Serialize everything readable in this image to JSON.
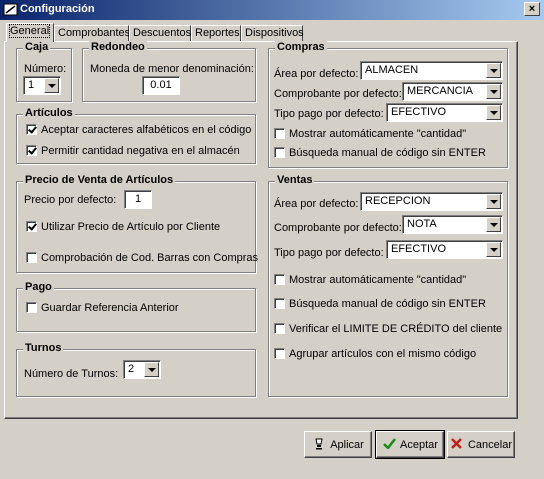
{
  "window": {
    "title": "Configuración",
    "close_glyph": "×",
    "icon": "config-icon"
  },
  "tabs": [
    {
      "label": "General",
      "active": true
    },
    {
      "label": "Comprobantes",
      "active": false
    },
    {
      "label": "Descuentos",
      "active": false
    },
    {
      "label": "Reportes",
      "active": false
    },
    {
      "label": "Dispositivos",
      "active": false
    }
  ],
  "caja": {
    "legend": "Caja",
    "numero_label": "Número:",
    "numero_value": "1"
  },
  "redondeo": {
    "legend": "Redondeo",
    "label": "Moneda de menor denominación:",
    "value": "0.01"
  },
  "articulos": {
    "legend": "Artículos",
    "opt1": {
      "label": "Aceptar caracteres alfabéticos en el código",
      "checked": true
    },
    "opt2": {
      "label": "Permitir cantidad negativa en el almacén",
      "checked": true
    }
  },
  "precio": {
    "legend": "Precio de Venta de Artículos",
    "defecto_label": "Precio por defecto:",
    "defecto_value": "1",
    "opt1": {
      "label": "Utilizar Precio de Artículo por Cliente",
      "checked": true
    },
    "opt2": {
      "label": "Comprobación de Cod. Barras con Compras",
      "checked": false
    }
  },
  "pago": {
    "legend": "Pago",
    "opt1": {
      "label": "Guardar Referencia Anterior",
      "checked": false
    }
  },
  "turnos": {
    "legend": "Turnos",
    "label": "Número de Turnos:",
    "value": "2"
  },
  "compras": {
    "legend": "Compras",
    "area_label": "Área por defecto:",
    "area_value": "ALMACEN",
    "comprobante_label": "Comprobante por defecto:",
    "comprobante_value": "MERCANCIA",
    "tipo_label": "Tipo pago por defecto:",
    "tipo_value": "EFECTIVO",
    "opt1": {
      "label": "Mostrar automáticamente \"cantidad\"",
      "checked": false
    },
    "opt2": {
      "label": "Búsqueda manual de código sin ENTER",
      "checked": false
    }
  },
  "ventas": {
    "legend": "Ventas",
    "area_label": "Área por defecto:",
    "area_value": "RECEPCION",
    "comprobante_label": "Comprobante por defecto:",
    "comprobante_value": "NOTA",
    "tipo_label": "Tipo pago por defecto:",
    "tipo_value": "EFECTIVO",
    "opt1": {
      "label": "Mostrar automáticamente \"cantidad\"",
      "checked": false
    },
    "opt2": {
      "label": "Búsqueda manual de código sin ENTER",
      "checked": false
    },
    "opt3": {
      "label": "Verificar el LIMITE DE CRÉDITO del cliente",
      "checked": false
    },
    "opt4": {
      "label": "Agrupar artículos con el mismo código",
      "checked": false
    }
  },
  "buttons": {
    "aplicar": "Aplicar",
    "aceptar": "Aceptar",
    "cancelar": "Cancelar"
  },
  "colors": {
    "titlebar_start": "#0a246a",
    "titlebar_end": "#a6caf0",
    "face": "#d4d0c8",
    "accept_check": "#1a8a1a",
    "cancel_x": "#c0201a"
  }
}
